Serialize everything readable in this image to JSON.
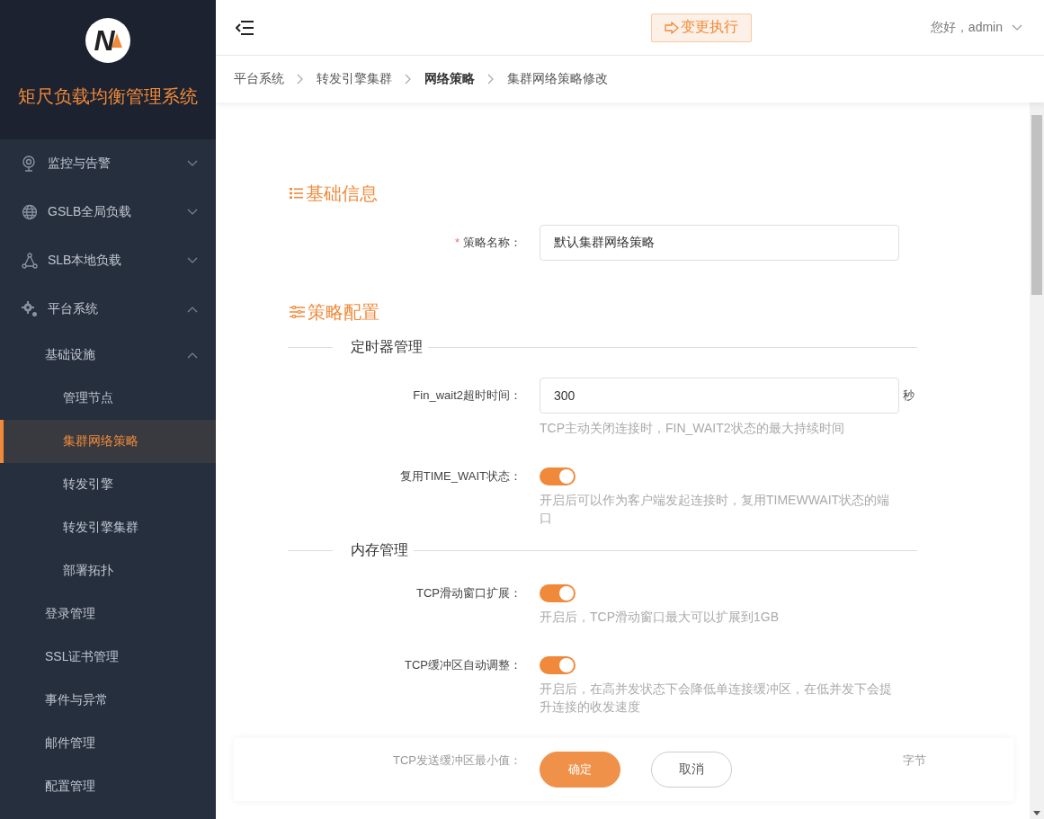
{
  "sidebar": {
    "logo_letter": "N",
    "title": "矩尺负载均衡管理系统",
    "menu": [
      {
        "label": "监控与告警",
        "expanded": false,
        "selected": false
      },
      {
        "label": "GSLB全局负载",
        "expanded": false,
        "selected": false
      },
      {
        "label": "SLB本地负载",
        "expanded": false,
        "selected": false
      },
      {
        "label": "平台系统",
        "expanded": true,
        "selected": false,
        "children": [
          {
            "label": "基础设施",
            "expanded": true,
            "selected": false,
            "children": [
              {
                "label": "管理节点",
                "selected": false
              },
              {
                "label": "集群网络策略",
                "selected": true
              },
              {
                "label": "转发引擎",
                "selected": false
              },
              {
                "label": "转发引擎集群",
                "selected": false
              },
              {
                "label": "部署拓扑",
                "selected": false
              }
            ]
          },
          {
            "label": "登录管理",
            "selected": false
          },
          {
            "label": "SSL证书管理",
            "selected": false
          },
          {
            "label": "事件与异常",
            "selected": false
          },
          {
            "label": "邮件管理",
            "selected": false
          },
          {
            "label": "配置管理",
            "selected": false
          }
        ]
      }
    ]
  },
  "header": {
    "change_button": "变更执行",
    "user": "您好，admin"
  },
  "breadcrumb": [
    {
      "label": "平台系统",
      "emphasized": false
    },
    {
      "label": "转发引擎集群",
      "emphasized": false
    },
    {
      "label": "网络策略",
      "emphasized": true
    },
    {
      "label": "集群网络策略修改",
      "emphasized": false
    }
  ],
  "sections": [
    {
      "title": "基础信息",
      "groups": [
        {
          "fields": [
            {
              "kind": "text",
              "label": "策略名称：",
              "required_mark": "*",
              "value": "默认集群网络策略"
            }
          ]
        }
      ]
    },
    {
      "title": "策略配置",
      "groups": [
        {
          "title": "定时器管理",
          "fields": [
            {
              "kind": "text",
              "label": "Fin_wait2超时时间：",
              "value": "300",
              "unit": "秒",
              "hint": "TCP主动关闭连接时，FIN_WAIT2状态的最大持续时间"
            },
            {
              "kind": "switch",
              "label": "复用TIME_WAIT状态：",
              "on": true,
              "hint": "开启后可以作为客户端发起连接时，复用TIMEWWAIT状态的端口"
            }
          ]
        },
        {
          "title": "内存管理",
          "fields": [
            {
              "kind": "switch",
              "label": "TCP滑动窗口扩展：",
              "on": true,
              "hint": "开启后，TCP滑动窗口最大可以扩展到1GB"
            },
            {
              "kind": "switch",
              "label": "TCP缓冲区自动调整：",
              "on": true,
              "hint": "开启后，在高并发状态下会降低单连接缓冲区，在低并发下会提升连接的收发速度"
            },
            {
              "kind": "text",
              "label": "TCP发送缓冲区最小值：",
              "unit": "字节"
            }
          ]
        }
      ]
    }
  ],
  "actions": [
    {
      "label": "确定",
      "kind": "primary"
    },
    {
      "label": "取消",
      "kind": "default"
    }
  ]
}
